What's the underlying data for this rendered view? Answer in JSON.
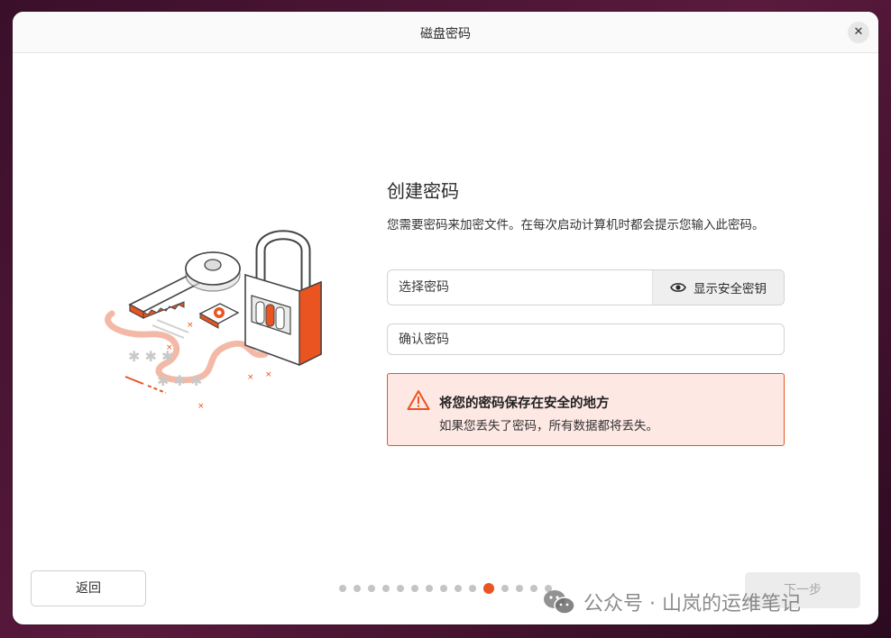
{
  "window": {
    "title": "磁盘密码"
  },
  "main": {
    "heading": "创建密码",
    "description": "您需要密码来加密文件。在每次启动计算机时都会提示您输入此密码。"
  },
  "password_field": {
    "placeholder": "选择密码",
    "value": ""
  },
  "show_key_button": {
    "label": "显示安全密钥",
    "icon": "eye-icon"
  },
  "confirm_field": {
    "placeholder": "确认密码",
    "value": ""
  },
  "warning": {
    "icon": "warning-triangle-icon",
    "title": "将您的密码保存在安全的地方",
    "body": "如果您丢失了密码，所有数据都将丢失。"
  },
  "footer": {
    "back_label": "返回",
    "next_label": "下一步",
    "steps": {
      "total": 15,
      "current": 11
    }
  },
  "watermark": {
    "text": "公众号 · 山岚的运维笔记"
  },
  "colors": {
    "accent": "#e95420",
    "warning_bg": "#fde8e4"
  }
}
